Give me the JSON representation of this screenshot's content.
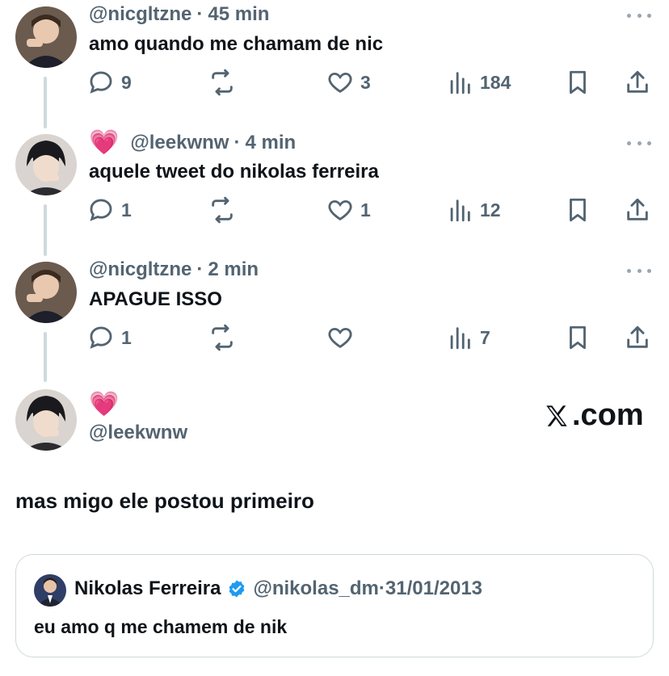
{
  "tweets": [
    {
      "heart": "",
      "handle": "@nicgltzne",
      "time": "45 min",
      "text": "amo quando me chamam de nic",
      "replies": "9",
      "retweets": "",
      "likes": "3",
      "views": "184"
    },
    {
      "heart": "💗",
      "handle": "@leekwnw",
      "time": "4 min",
      "text": "aquele tweet do nikolas ferreira",
      "replies": "1",
      "retweets": "",
      "likes": "1",
      "views": "12"
    },
    {
      "heart": "",
      "handle": "@nicgltzne",
      "time": "2 min",
      "text": "APAGUE ISSO",
      "replies": "1",
      "retweets": "",
      "likes": "",
      "views": "7"
    }
  ],
  "main": {
    "heart": "💗",
    "handle": "@leekwnw",
    "brand": ".com",
    "text": "mas migo ele postou primeiro"
  },
  "quote": {
    "name": "Nikolas Ferreira",
    "handle": "@nikolas_dm",
    "date": "31/01/2013",
    "text": "eu amo q me chamem de nik"
  },
  "colors": {
    "text": "#0f1419",
    "secondary": "#536471",
    "heart": "#f91880",
    "verified": "#1d9bf0",
    "border": "#cfd9de"
  }
}
